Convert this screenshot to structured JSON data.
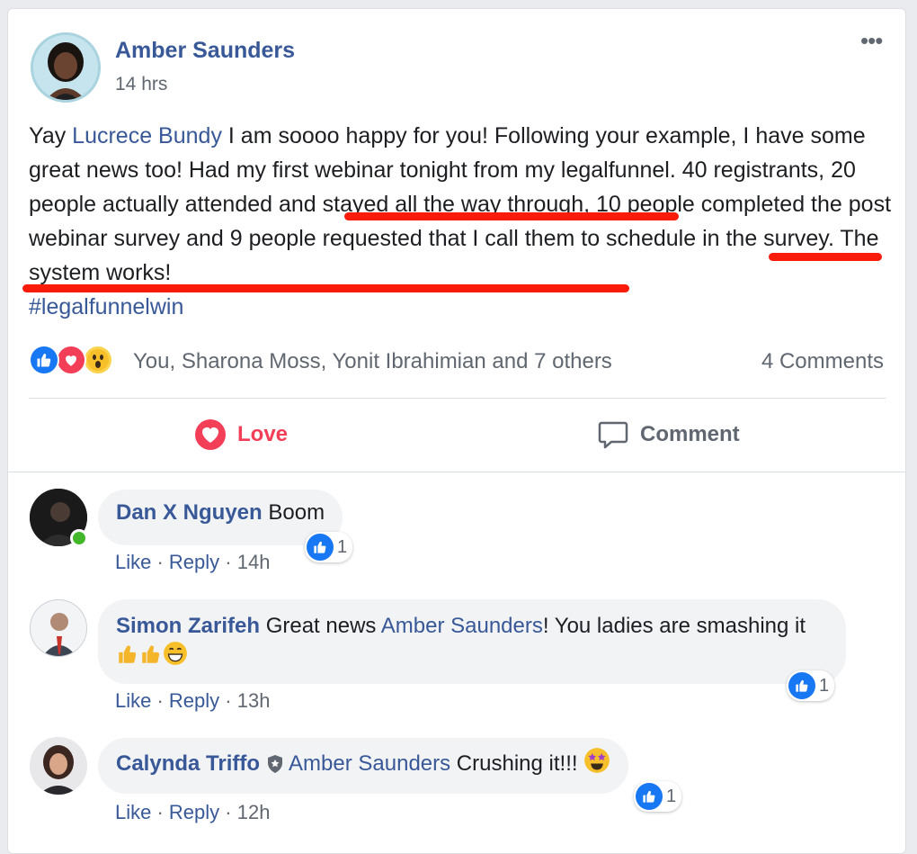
{
  "post": {
    "author": "Amber Saunders",
    "time": "14 hrs",
    "more_icon": "•••",
    "text": {
      "p1": "Yay ",
      "mention": "Lucrece Bundy",
      "p2": " I am soooo happy for you! Following your example, I have some great news too! Had my first webinar tonight from my legalfunnel. 40 registrants, ",
      "u1": "20 people actually attended",
      "p3": " and stayed all the way through, 10 people completed the post webinar survey and ",
      "u2": "9 people requested that I call them to schedule in the survey",
      "p4": ". The system works!",
      "hashtag": "#legalfunnelwin"
    },
    "reactions": {
      "icons": [
        "like-icon",
        "love-icon",
        "wow-icon"
      ],
      "summary": "You, Sharona Moss, Yonit Ibrahimian and 7 others",
      "comments_count": "4 Comments"
    },
    "actions": {
      "love_label": "Love",
      "comment_label": "Comment"
    },
    "underline_color": "#fb1b0b"
  },
  "comments": [
    {
      "name": "Dan X Nguyen",
      "text": " Boom",
      "like": "Like",
      "reply": "Reply",
      "sep": " · ",
      "time": "14h",
      "reaction_count": "1"
    },
    {
      "name": "Simon Zarifeh",
      "text_a": " Great news ",
      "mention": "Amber Saunders",
      "text_b": "! You ladies are smashing it ",
      "emojis": [
        "thumbs-up",
        "thumbs-up",
        "grinning"
      ],
      "like": "Like",
      "reply": "Reply",
      "sep": " · ",
      "time": "13h",
      "reaction_count": "1"
    },
    {
      "name": "Calynda Triffo",
      "badge_icon": "shield-icon",
      "mention": "Amber Saunders",
      "text": " Crushing it!!! ",
      "emoji": "star-struck",
      "like": "Like",
      "reply": "Reply",
      "sep": " · ",
      "time": "12h",
      "reaction_count": "1"
    }
  ],
  "colors": {
    "link": "#385898",
    "love": "#f33e58",
    "like": "#1877f2",
    "online": "#42b72a"
  }
}
